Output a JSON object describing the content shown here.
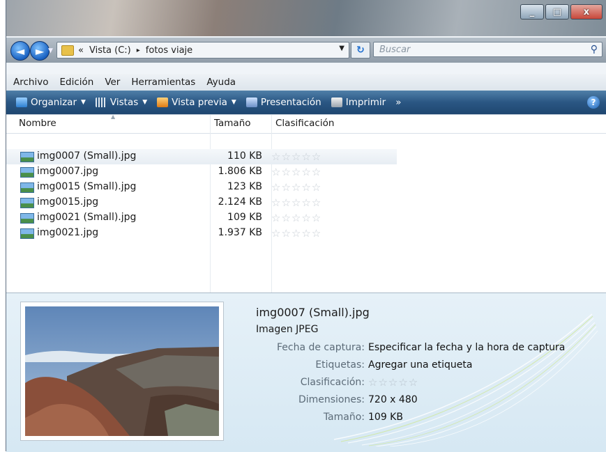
{
  "window": {
    "controls": {
      "minimize": "_",
      "maximize": "□",
      "close": "x"
    }
  },
  "nav": {
    "back_glyph": "◄",
    "forward_glyph": "►",
    "address": {
      "prefix": "«",
      "segments": [
        "Vista (C:)",
        "fotos viaje"
      ],
      "separator": "▸"
    },
    "refresh_glyph": "↻",
    "search_placeholder": "Buscar"
  },
  "menubar": [
    "Archivo",
    "Edición",
    "Ver",
    "Herramientas",
    "Ayuda"
  ],
  "toolbar": {
    "organize": "Organizar",
    "views": "Vistas",
    "preview": "Vista previa",
    "slideshow": "Presentación",
    "print": "Imprimir",
    "more": "»",
    "help": "?"
  },
  "columns": {
    "name": "Nombre",
    "size": "Tamaño",
    "rating": "Clasificación"
  },
  "files": [
    {
      "name": "img0007 (Small).jpg",
      "size": "110 KB",
      "rating": 0,
      "selected": true
    },
    {
      "name": "img0007.jpg",
      "size": "1.806 KB",
      "rating": 0
    },
    {
      "name": "img0015 (Small).jpg",
      "size": "123 KB",
      "rating": 0
    },
    {
      "name": "img0015.jpg",
      "size": "2.124 KB",
      "rating": 0
    },
    {
      "name": "img0021 (Small).jpg",
      "size": "109 KB",
      "rating": 0
    },
    {
      "name": "img0021.jpg",
      "size": "1.937 KB",
      "rating": 0
    }
  ],
  "details": {
    "title": "img0007 (Small).jpg",
    "type": "Imagen JPEG",
    "props": [
      {
        "label": "Fecha de captura:",
        "value": "Especificar la fecha y la hora de captura"
      },
      {
        "label": "Etiquetas:",
        "value": "Agregar una etiqueta"
      },
      {
        "label": "Clasificación:",
        "value": "☆☆☆☆☆"
      },
      {
        "label": "Dimensiones:",
        "value": "720 x 480"
      },
      {
        "label": "Tamaño:",
        "value": "109 KB"
      }
    ]
  },
  "stars_empty": "☆☆☆☆☆"
}
